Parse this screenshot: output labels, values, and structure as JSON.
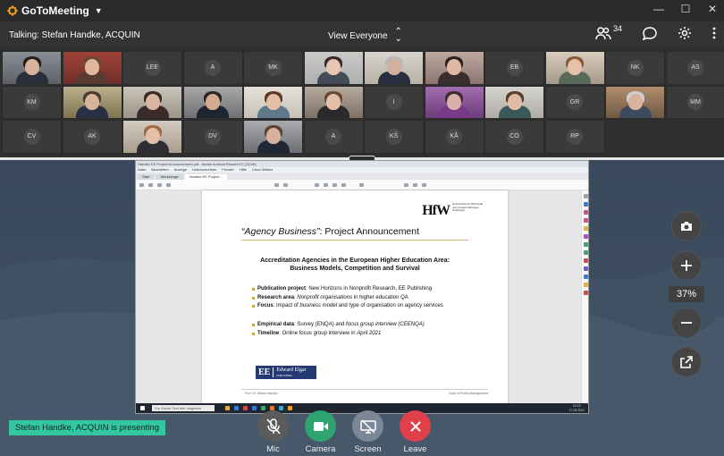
{
  "app": {
    "name": "GoToMeeting",
    "window_controls": [
      "minimize",
      "maximize",
      "close"
    ]
  },
  "talkbar": {
    "talking": "Talking: Stefan Handke, ACQUIN",
    "view": "View Everyone",
    "attendee_count": "34"
  },
  "participants": [
    {
      "type": "video",
      "skin": "#d9b39b",
      "hair": "#2a1c18",
      "shirt": "#2b2f3a",
      "c1": "#8a8e96",
      "c2": "#5e6168"
    },
    {
      "type": "video",
      "skin": "#e1b79c",
      "hair": "#6a4a30",
      "shirt": "#5a3b30",
      "c1": "#a04236",
      "c2": "#70302b"
    },
    {
      "type": "avatar",
      "initials": "LEE"
    },
    {
      "type": "avatar",
      "initials": "A"
    },
    {
      "type": "avatar",
      "initials": "MK"
    },
    {
      "type": "video",
      "skin": "#e7c7b3",
      "hair": "#3a2a28",
      "shirt": "#444c5a",
      "c1": "#c9c9c6",
      "c2": "#aeb0ae"
    },
    {
      "type": "video",
      "skin": "#d4b0a0",
      "hair": "#b8b8b8",
      "shirt": "#2a2f40",
      "c1": "#d8d4cc",
      "c2": "#b8b2a8"
    },
    {
      "type": "video",
      "skin": "#ddb8a2",
      "hair": "#2d2320",
      "shirt": "#3a2f2f",
      "c1": "#bda9a0",
      "c2": "#8b7670"
    },
    {
      "type": "avatar",
      "initials": "EB"
    },
    {
      "type": "video",
      "skin": "#e5c1aa",
      "hair": "#8a5a3a",
      "shirt": "#5a6a5a",
      "c1": "#d8cdbc",
      "c2": "#a59a8a"
    },
    {
      "type": "avatar",
      "initials": "NK"
    },
    {
      "type": "avatar",
      "initials": "AS"
    },
    {
      "type": "avatar",
      "initials": "KM"
    },
    {
      "type": "video",
      "skin": "#d8b39b",
      "hair": "#4a3a30",
      "shirt": "#2a3044",
      "c1": "#bdb18c",
      "c2": "#7d7350"
    },
    {
      "type": "video",
      "skin": "#d9b6a0",
      "hair": "#3a2a22",
      "shirt": "#3d2b2b",
      "c1": "#c9c4ba",
      "c2": "#9d9488"
    },
    {
      "type": "video",
      "skin": "#d5ab90",
      "hair": "#2c2420",
      "shirt": "#1e2430",
      "c1": "#a8a8aa",
      "c2": "#707074"
    },
    {
      "type": "video",
      "skin": "#e3bda5",
      "hair": "#5a3a26",
      "shirt": "#5e7a8a",
      "c1": "#e6e2da",
      "c2": "#c7c0b4"
    },
    {
      "type": "video",
      "skin": "#e4c0aa",
      "hair": "#6a4a36",
      "shirt": "#2a2a2e",
      "c1": "#b7aba0",
      "c2": "#7d6f64"
    },
    {
      "type": "avatar",
      "initials": "I"
    },
    {
      "type": "video",
      "skin": "#d8b0a8",
      "hair": "#3a2a30",
      "shirt": "#7a3a8a",
      "c1": "#a36cb0",
      "c2": "#6c3e7a"
    },
    {
      "type": "video",
      "skin": "#e1bca4",
      "hair": "#5a3e2e",
      "shirt": "#3a5a5a",
      "c1": "#d5d4cf",
      "c2": "#b0aca5"
    },
    {
      "type": "avatar",
      "initials": "GR"
    },
    {
      "type": "video",
      "skin": "#d9b39d",
      "hair": "#cfcfcf",
      "shirt": "#3e4b5e",
      "c1": "#b08c6c",
      "c2": "#6f5a44"
    },
    {
      "type": "avatar",
      "initials": "MM"
    },
    {
      "type": "avatar",
      "initials": "CV"
    },
    {
      "type": "avatar",
      "initials": "AK"
    },
    {
      "type": "video",
      "skin": "#e2c0a8",
      "hair": "#a06a40",
      "shirt": "#2e2e34",
      "c1": "#d3cbc0",
      "c2": "#a89d8e"
    },
    {
      "type": "avatar",
      "initials": "DV"
    },
    {
      "type": "video",
      "skin": "#d7b19b",
      "hair": "#5a4036",
      "shirt": "#202838",
      "c1": "#a9abad",
      "c2": "#6c6e72"
    },
    {
      "type": "avatar",
      "initials": "A"
    },
    {
      "type": "avatar",
      "initials": "KŠ"
    },
    {
      "type": "avatar",
      "initials": "KÅ"
    },
    {
      "type": "avatar",
      "initials": "CO"
    },
    {
      "type": "avatar",
      "initials": "RP"
    }
  ],
  "shared_screen": {
    "app_title": "Handke EE Project Announcement.pdf - Adobe Acrobat Reader DC (32-bit)",
    "menu": [
      "Datei",
      "Bearbeiten",
      "Anzeige",
      "Unterschreiben",
      "Fenster",
      "Hilfe",
      "Cisco Webex"
    ],
    "tabs": [
      "Start",
      "Werkzeuge",
      "Handke EE Project..."
    ],
    "search_placeholder": "Zur Suche Text hier eingeben",
    "clock": {
      "time": "10:19",
      "date": "17.03.2021"
    },
    "page": {
      "logo_mark": "HfW",
      "logo_text": "Hochschule für Wirtschaft und Umwelt Nürtingen-Geislingen",
      "title_italic": "“Agency Business”",
      "title_rest": ": Project Announcement",
      "heading1": "Accreditation Agencies in the European Higher Education Area:",
      "heading2": "Business Models, Competition and Survival",
      "bullets1": [
        {
          "label": "Publication project",
          "text": ": New Horizons in Nonprofit Research, EE Publishing"
        },
        {
          "label": "Research area",
          "text": ": ",
          "italic": "Nonprofit organisations",
          "tail": " in higher education QA"
        },
        {
          "label": "Focus",
          "text": ": Impact of ",
          "italic": "business model",
          "tail": " and type of organisation on agency services"
        }
      ],
      "bullets2": [
        {
          "label": "Empirical data",
          "text": ": Survey (ENQA) and ",
          "italic": "focus group interview (CEENQA)",
          "tail": ""
        },
        {
          "label": "Timeline",
          "text": ": Online focus group interview in ",
          "italic": "April 2021",
          "tail": ""
        }
      ],
      "publisher_mark": "EE",
      "publisher_name": "Edward Elgar",
      "publisher_sub": "PUBLISHING",
      "footer_left": "Prof. Dr. Stefan Handke",
      "footer_right": "Chair of Public Management"
    }
  },
  "zoom": {
    "percent": "37%"
  },
  "presenting": "Stefan Handke, ACQUIN is presenting",
  "controls": [
    {
      "label": "Mic",
      "color": "#5b5b5b"
    },
    {
      "label": "Camera",
      "color": "#2fa370"
    },
    {
      "label": "Screen",
      "color": "#7b8796"
    },
    {
      "label": "Leave",
      "color": "#e0404a"
    }
  ],
  "colors": {
    "accent": "#33c6a0",
    "logo": "#f3a21c",
    "leave": "#e0404a"
  }
}
